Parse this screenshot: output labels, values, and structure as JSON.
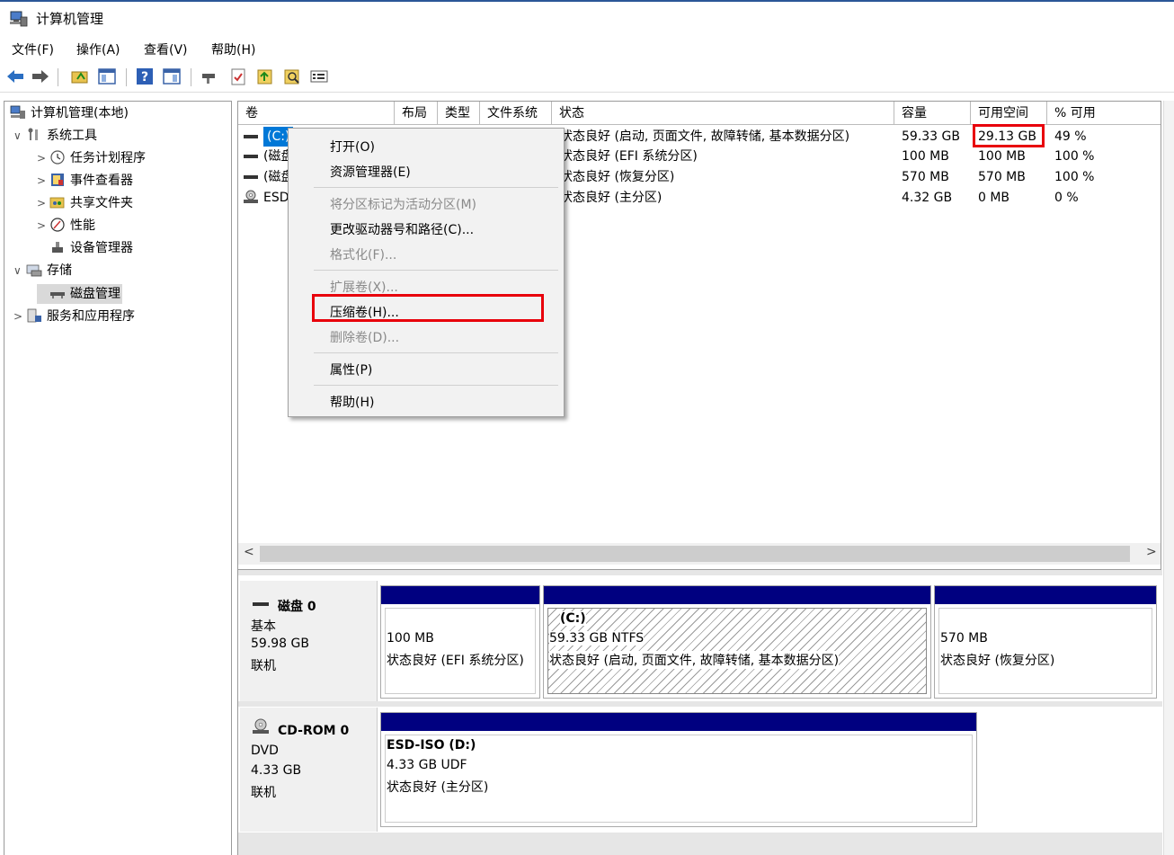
{
  "window": {
    "title": "计算机管理"
  },
  "menu": [
    "文件(F)",
    "操作(A)",
    "查看(V)",
    "帮助(H)"
  ],
  "toolbar_icons": [
    "back-arrow-icon",
    "forward-arrow-icon",
    "folder-up-icon",
    "show-hide-tree-icon",
    "help-icon",
    "console-view-icon",
    "connect-icon",
    "checklist-icon",
    "up-arrow-icon",
    "search-icon",
    "properties-icon"
  ],
  "tree": [
    {
      "label": "计算机管理(本地)",
      "level": 0,
      "arrow": "",
      "icon": "computer-management-icon"
    },
    {
      "label": "系统工具",
      "level": 1,
      "arrow": "∨",
      "icon": "tools-icon"
    },
    {
      "label": "任务计划程序",
      "level": 2,
      "arrow": ">",
      "icon": "clock-icon"
    },
    {
      "label": "事件查看器",
      "level": 2,
      "arrow": ">",
      "icon": "event-viewer-icon"
    },
    {
      "label": "共享文件夹",
      "level": 2,
      "arrow": ">",
      "icon": "shared-folder-icon"
    },
    {
      "label": "性能",
      "level": 2,
      "arrow": ">",
      "icon": "performance-icon"
    },
    {
      "label": "设备管理器",
      "level": 2,
      "arrow": "",
      "icon": "device-manager-icon"
    },
    {
      "label": "存储",
      "level": 1,
      "arrow": "∨",
      "icon": "storage-icon"
    },
    {
      "label": "磁盘管理",
      "level": 2,
      "arrow": "",
      "icon": "disk-management-icon",
      "selected": true
    },
    {
      "label": "服务和应用程序",
      "level": 1,
      "arrow": ">",
      "icon": "services-icon"
    }
  ],
  "volume_table": {
    "headers": [
      "卷",
      "布局",
      "类型",
      "文件系统",
      "状态",
      "容量",
      "可用空间",
      "% 可用"
    ],
    "rows": [
      {
        "vol": "(C:)",
        "status": "状态良好 (启动, 页面文件, 故障转储, 基本数据分区)",
        "capacity": "59.33 GB",
        "free": "29.13 GB",
        "pct": "49 %",
        "selected": true
      },
      {
        "vol": "(磁盘",
        "status": "状态良好 (EFI 系统分区)",
        "capacity": "100 MB",
        "free": "100 MB",
        "pct": "100 %"
      },
      {
        "vol": "(磁盘",
        "status": "状态良好 (恢复分区)",
        "capacity": "570 MB",
        "free": "570 MB",
        "pct": "100 %"
      },
      {
        "vol": "ESD",
        "status": "状态良好 (主分区)",
        "capacity": "4.32 GB",
        "free": "0 MB",
        "pct": "0 %"
      }
    ]
  },
  "context_menu": [
    {
      "label": "打开(O)",
      "disabled": false
    },
    {
      "label": "资源管理器(E)",
      "disabled": false
    },
    {
      "label": "将分区标记为活动分区(M)",
      "disabled": true
    },
    {
      "label": "更改驱动器号和路径(C)...",
      "disabled": false
    },
    {
      "label": "格式化(F)...",
      "disabled": true
    },
    {
      "label": "扩展卷(X)...",
      "disabled": true
    },
    {
      "label": "压缩卷(H)...",
      "disabled": false,
      "highlighted": true
    },
    {
      "label": "删除卷(D)...",
      "disabled": true
    },
    {
      "label": "属性(P)",
      "disabled": false
    },
    {
      "label": "帮助(H)",
      "disabled": false
    }
  ],
  "disks": [
    {
      "name": "磁盘 0",
      "type": "基本",
      "size": "59.98 GB",
      "state": "联机",
      "partitions": [
        {
          "title": "",
          "line1": "100 MB",
          "line2": "状态良好 (EFI 系统分区)"
        },
        {
          "title": "(C:)",
          "line1": "59.33 GB NTFS",
          "line2": "状态良好 (启动, 页面文件, 故障转储, 基本数据分区)",
          "hatched": true
        },
        {
          "title": "",
          "line1": "570 MB",
          "line2": "状态良好 (恢复分区)"
        }
      ]
    },
    {
      "name": "CD-ROM 0",
      "type": "DVD",
      "size": "4.33 GB",
      "state": "联机",
      "partitions": [
        {
          "title": "ESD-ISO  (D:)",
          "line1": "4.33 GB UDF",
          "line2": "状态良好 (主分区)"
        }
      ]
    }
  ],
  "colors": {
    "accent_bar": "#000080",
    "highlight_box": "#e8000b",
    "selection": "#0078d7"
  }
}
